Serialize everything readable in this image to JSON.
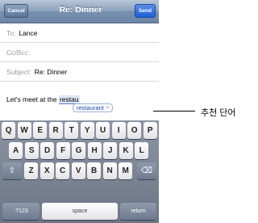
{
  "nav": {
    "cancel": "Cancel",
    "title": "Re: Dinner",
    "send": "Send"
  },
  "fields": {
    "to_label": "To:",
    "to_value": "Lance",
    "cc_label": "Cc/Bcc:",
    "subject_label": "Subject:",
    "subject_value": "Re: Dinner"
  },
  "body": {
    "prefix": "Let's meet at the ",
    "typed": "restau"
  },
  "suggestion": {
    "word": "restaurant",
    "dismiss": "×"
  },
  "keyboard": {
    "row1": [
      "Q",
      "W",
      "E",
      "R",
      "T",
      "Y",
      "U",
      "I",
      "O",
      "P"
    ],
    "row2": [
      "A",
      "S",
      "D",
      "F",
      "G",
      "H",
      "J",
      "K",
      "L"
    ],
    "row3": [
      "Z",
      "X",
      "C",
      "V",
      "B",
      "N",
      "M"
    ],
    "shift": "⇧",
    "delete": "⌫",
    "numbers": ".?123",
    "space": "space",
    "return": "return"
  },
  "callout": "추천 단어"
}
